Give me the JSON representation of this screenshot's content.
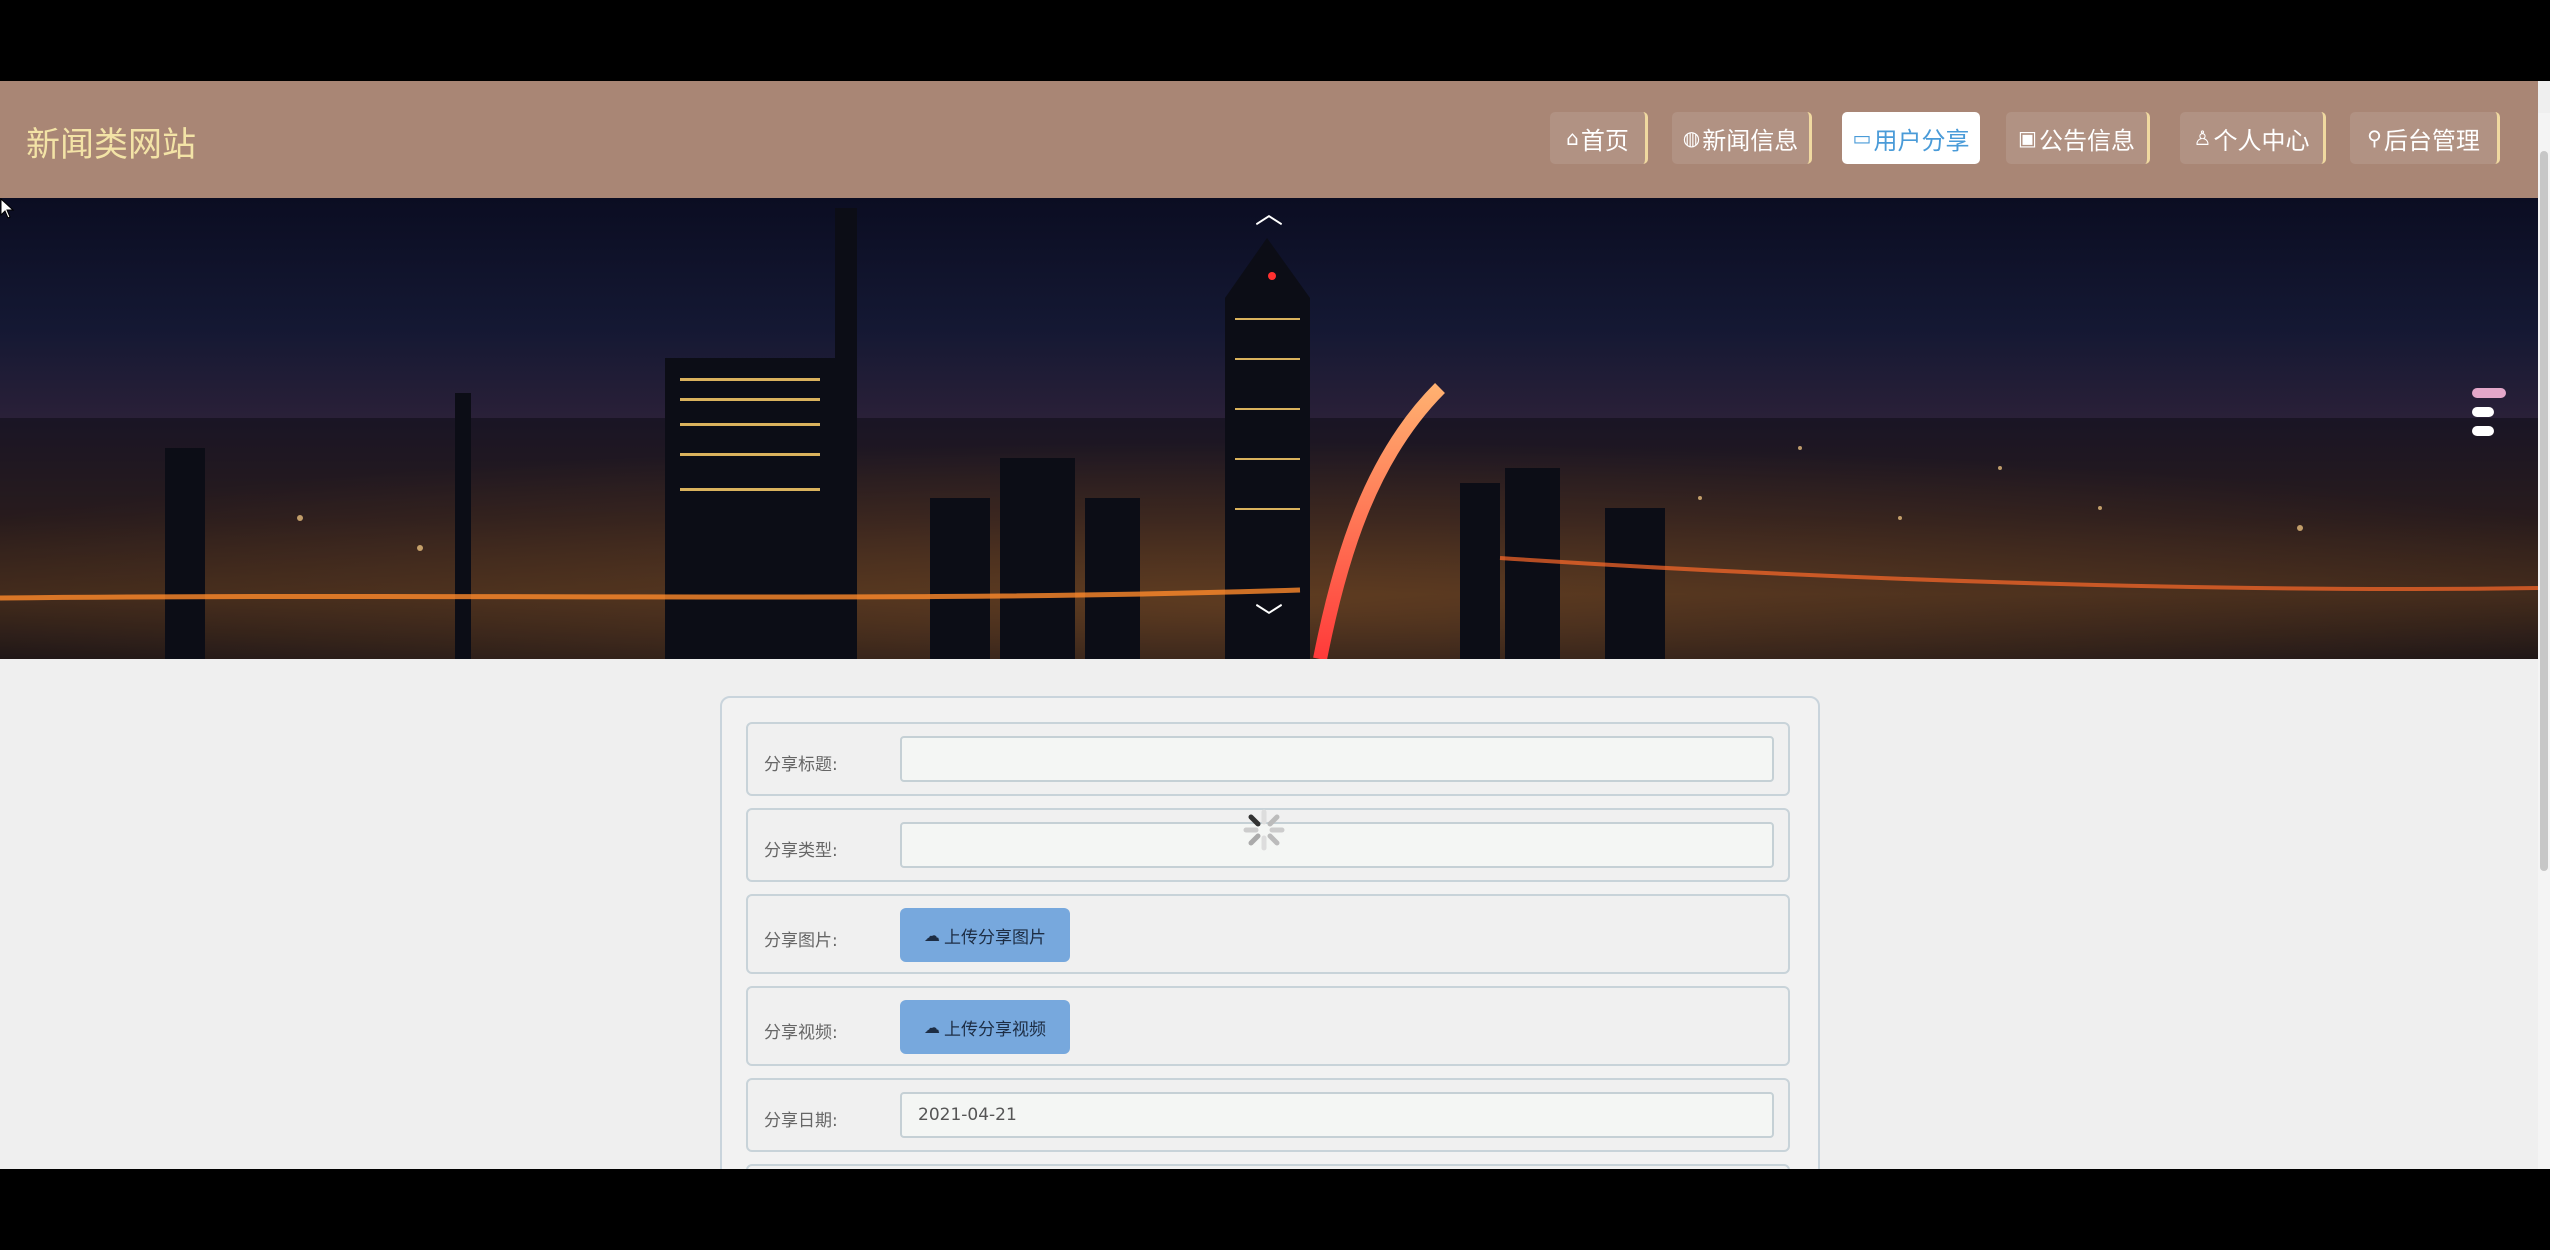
{
  "header": {
    "site_title": "新闻类网站",
    "nav": [
      {
        "icon": "home-icon",
        "glyph": "⌂",
        "label": "首页"
      },
      {
        "icon": "globe-icon",
        "glyph": "◍",
        "label": "新闻信息"
      },
      {
        "icon": "share-icon",
        "glyph": "▭",
        "label": "用户分享",
        "active": true
      },
      {
        "icon": "notice-icon",
        "glyph": "▣",
        "label": "公告信息"
      },
      {
        "icon": "user-icon",
        "glyph": "♙",
        "label": "个人中心"
      },
      {
        "icon": "link-icon",
        "glyph": "⚲",
        "label": "后台管理"
      }
    ]
  },
  "banner": {
    "prev_glyph": "︿",
    "next_glyph": "﹀",
    "slide_count": 3,
    "active_slide": 1
  },
  "form": {
    "fields": [
      {
        "label": "分享标题:",
        "type": "text",
        "value": ""
      },
      {
        "label": "分享类型:",
        "type": "select",
        "value": ""
      },
      {
        "label": "分享图片:",
        "type": "upload",
        "button_label": "上传分享图片"
      },
      {
        "label": "分享视频:",
        "type": "upload",
        "button_label": "上传分享视频"
      },
      {
        "label": "分享日期:",
        "type": "text",
        "value": "2021-04-21"
      }
    ],
    "upload_icon": "cloud-upload-icon"
  },
  "colors": {
    "header_bg": "#a98675",
    "title_color": "#f3e3a6",
    "active_nav_text": "#4a9bd8",
    "upload_button_bg": "#77a8dd",
    "active_dot": "#e3a7c9"
  }
}
